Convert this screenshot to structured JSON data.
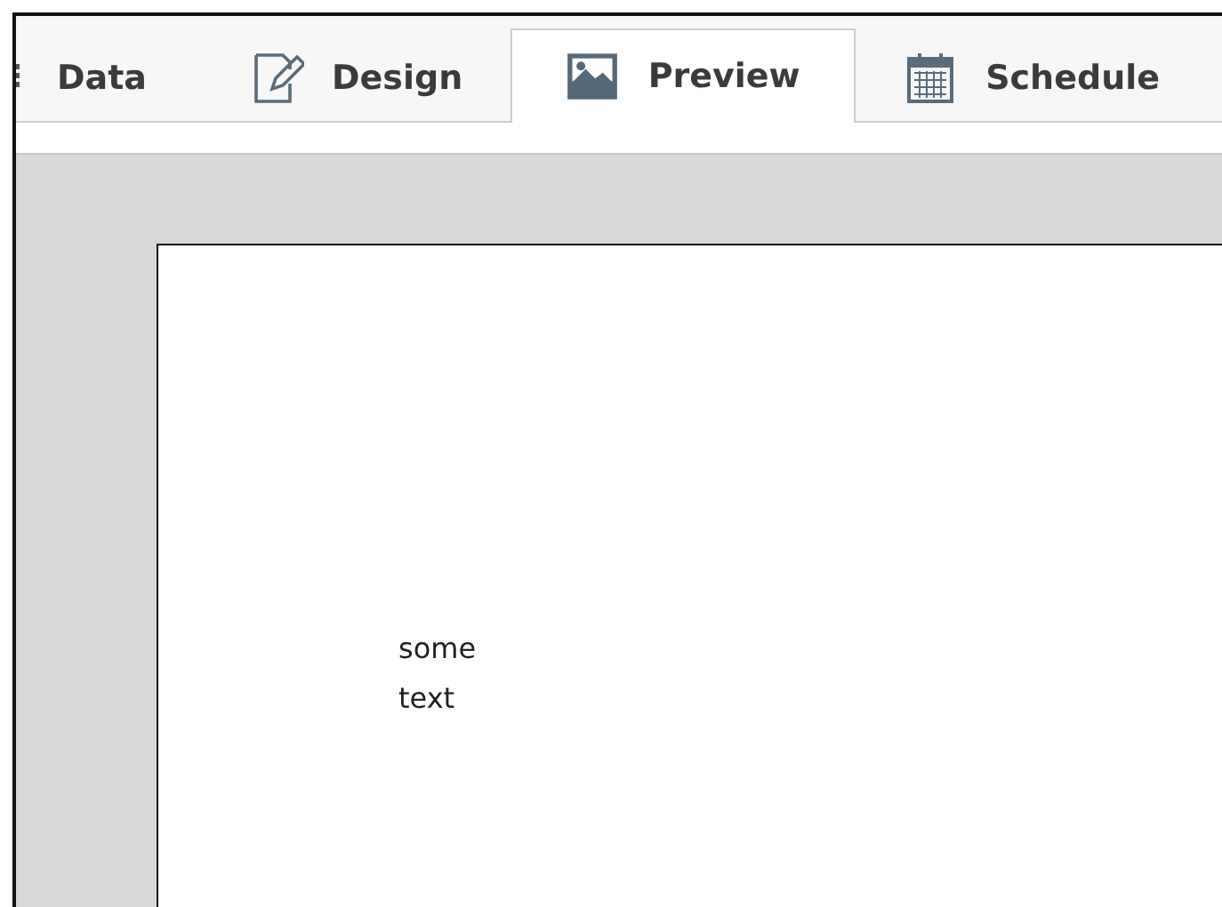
{
  "tabs": [
    {
      "label": "Data",
      "kind": "plain",
      "selected": false
    },
    {
      "label": "Design",
      "kind": "editor",
      "selected": false
    },
    {
      "label": "Preview",
      "kind": "preview",
      "selected": true
    },
    {
      "label": "Schedule",
      "kind": "schedule",
      "selected": false
    }
  ],
  "page": {
    "text": "some text"
  }
}
